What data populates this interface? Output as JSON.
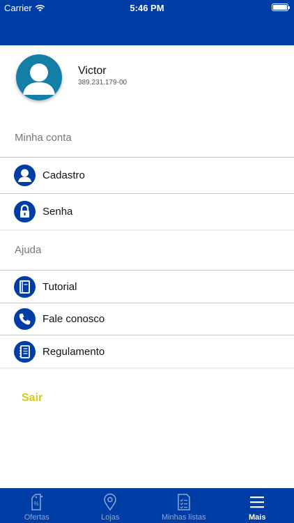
{
  "status_bar": {
    "carrier": "Carrier",
    "time": "5:46 PM"
  },
  "profile": {
    "name": "Victor",
    "document": "389.231.179-00"
  },
  "sections": {
    "account": {
      "title": "Minha conta",
      "items": [
        {
          "label": "Cadastro",
          "icon": "user-icon"
        },
        {
          "label": "Senha",
          "icon": "lock-icon"
        }
      ]
    },
    "help": {
      "title": "Ajuda",
      "items": [
        {
          "label": "Tutorial",
          "icon": "book-icon"
        },
        {
          "label": "Fale conosco",
          "icon": "phone-icon"
        },
        {
          "label": "Regulamento",
          "icon": "notebook-icon"
        }
      ]
    }
  },
  "logout_label": "Sair",
  "tabs": [
    {
      "label": "Ofertas",
      "icon": "discount-tag-icon",
      "active": false
    },
    {
      "label": "Lojas",
      "icon": "map-pin-icon",
      "active": false
    },
    {
      "label": "Minhas listas",
      "icon": "checklist-icon",
      "active": false
    },
    {
      "label": "Mais",
      "icon": "menu-icon",
      "active": true
    }
  ],
  "colors": {
    "primary": "#003da5",
    "logout": "#d4c820",
    "tab_inactive": "#8fa8d8",
    "avatar_bg": "#137fa6"
  }
}
